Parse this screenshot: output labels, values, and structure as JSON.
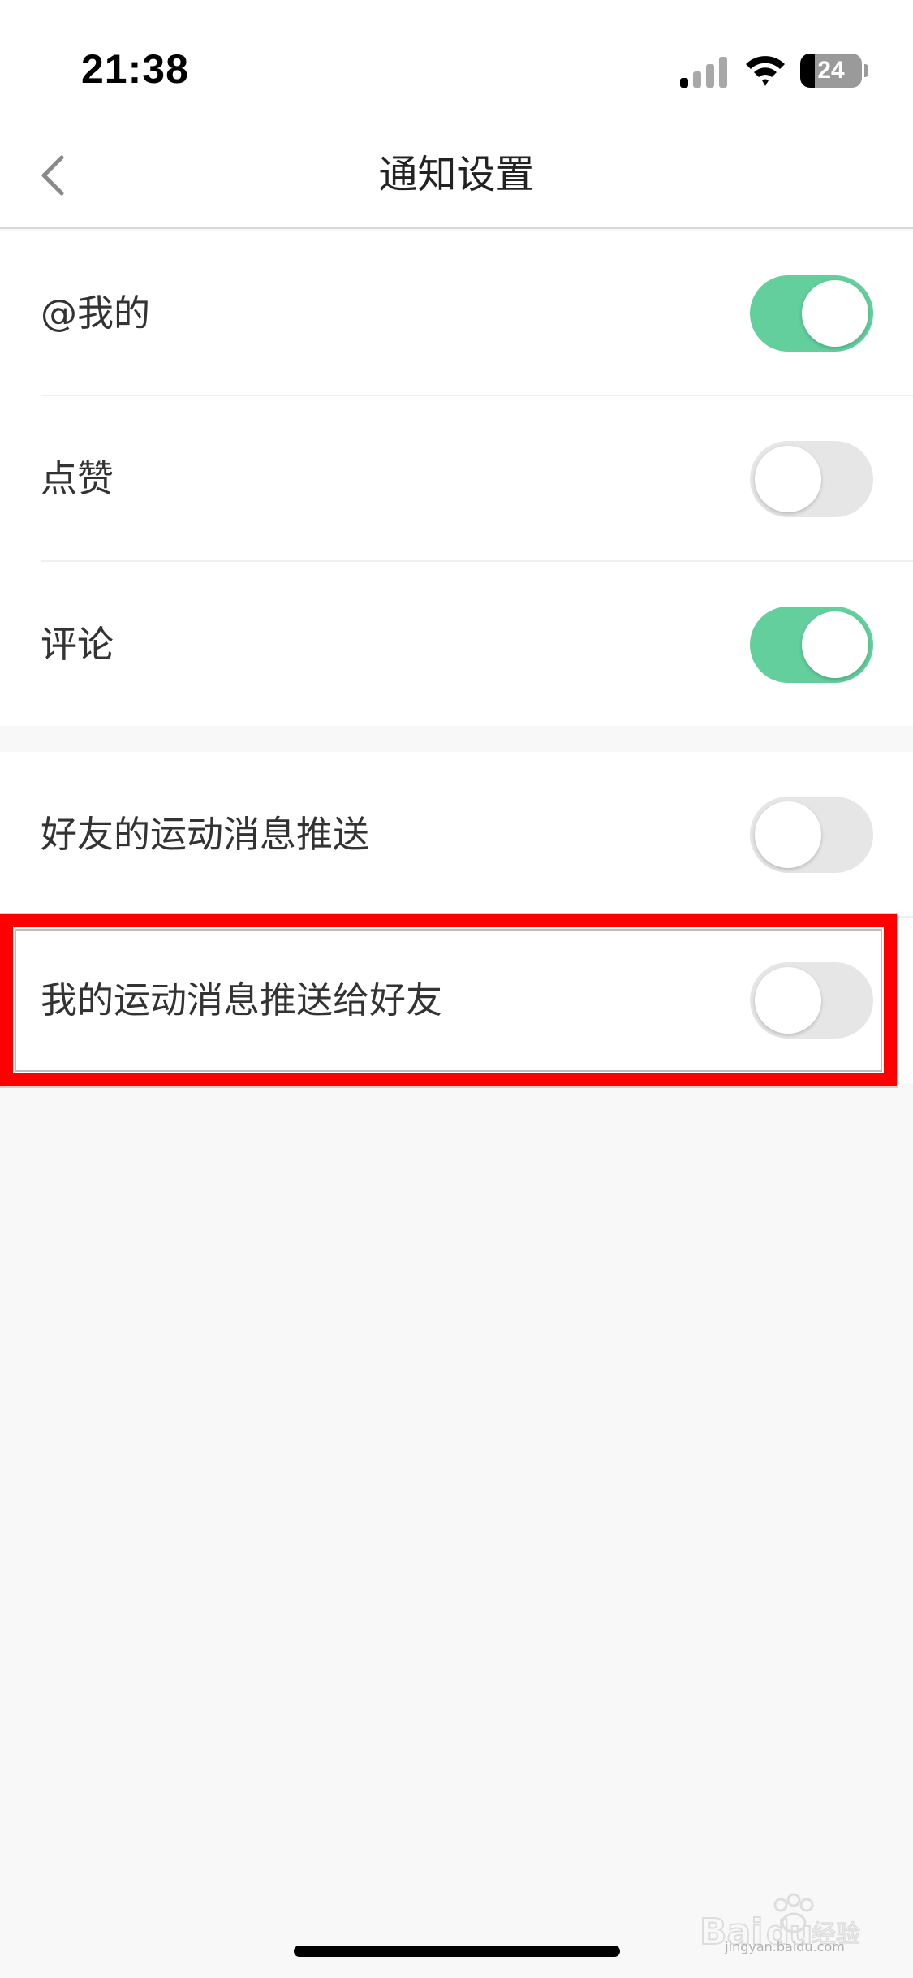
{
  "status_bar": {
    "time": "21:38",
    "battery_level": "24",
    "battery_fraction": 0.24,
    "signal_icon": "cellular-signal-icon",
    "wifi_icon": "wifi-icon",
    "battery_icon": "battery-icon"
  },
  "nav": {
    "title": "通知设置",
    "back_icon": "chevron-left-icon"
  },
  "settings": {
    "group_1": [
      {
        "label": "@我的",
        "enabled": true
      },
      {
        "label": "点赞",
        "enabled": false
      },
      {
        "label": "评论",
        "enabled": true
      }
    ],
    "group_2": [
      {
        "label": "好友的运动消息推送",
        "enabled": false
      },
      {
        "label": "我的运动消息推送给好友",
        "enabled": false
      }
    ]
  },
  "colors": {
    "toggle_on": "#62cf9d",
    "toggle_off": "#e6e6e6",
    "highlight": "#ff0000",
    "background": "#f8f8f8"
  },
  "watermark": {
    "logo": "Baidu经验",
    "url": "jingyan.baidu.com"
  }
}
